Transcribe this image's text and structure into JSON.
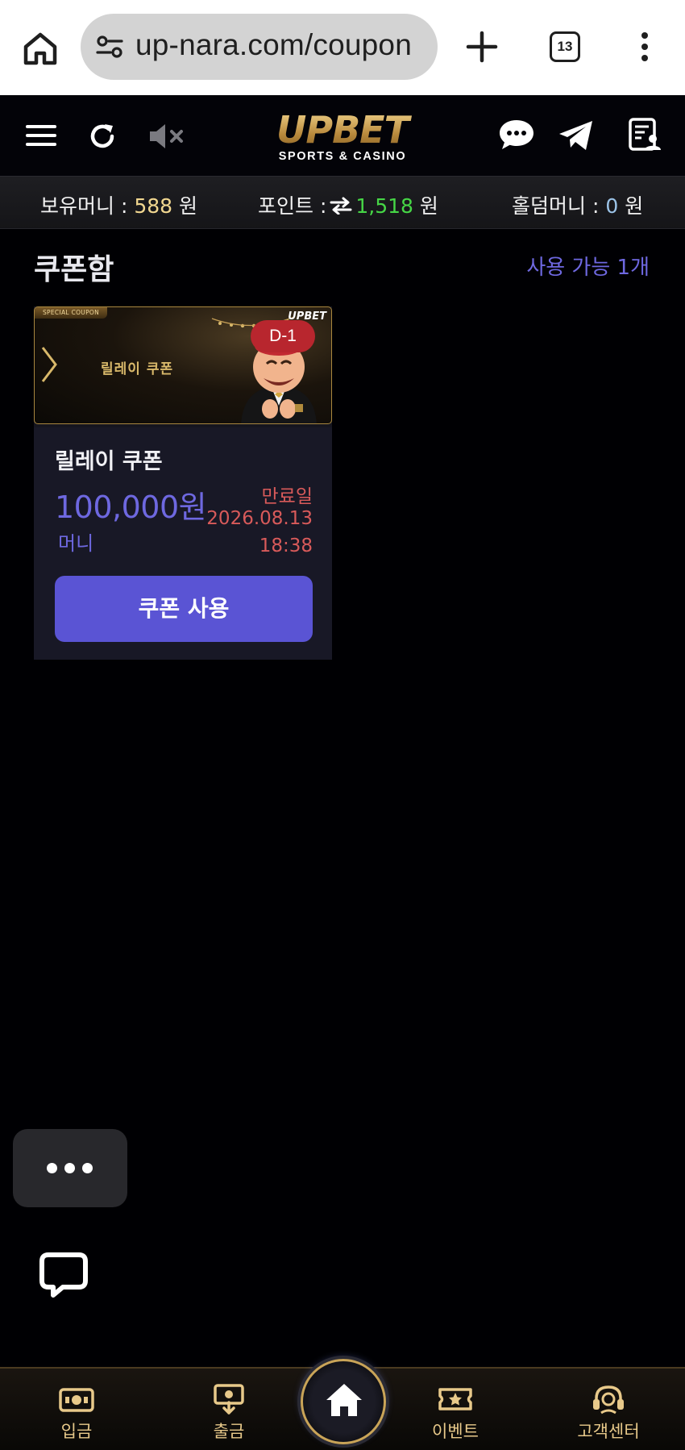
{
  "browser": {
    "url": "up-nara.com/coupon",
    "tab_count": "13"
  },
  "site": {
    "brand_main": "UPBET",
    "brand_sub": "SPORTS & CASINO"
  },
  "balances": {
    "money_label": "보유머니 :",
    "money_value": "588",
    "money_unit": "원",
    "point_label": "포인트 :",
    "point_value": "1,518",
    "point_unit": "원",
    "holdem_label": "홀덤머니 :",
    "holdem_value": "0",
    "holdem_unit": "원"
  },
  "page": {
    "title": "쿠폰함",
    "available": "사용 가능 1개"
  },
  "coupon": {
    "banner_tag": "SPECIAL COUPON",
    "banner_text": "릴레이 쿠폰",
    "banner_logo": "UPBET",
    "dday": "D-1",
    "name": "릴레이 쿠폰",
    "amount": "100,000원",
    "unit": "머니",
    "expire_label": "만료일",
    "expire_date": "2026.08.13",
    "expire_time": "18:38",
    "use_button": "쿠폰 사용"
  },
  "bottom_nav": {
    "deposit": "입금",
    "withdraw": "출금",
    "event": "이벤트",
    "support": "고객센터"
  },
  "colors": {
    "accent": "#5a54d4",
    "gold": "#c9a458",
    "expire": "#d85a5a",
    "point_green": "#46d646"
  }
}
